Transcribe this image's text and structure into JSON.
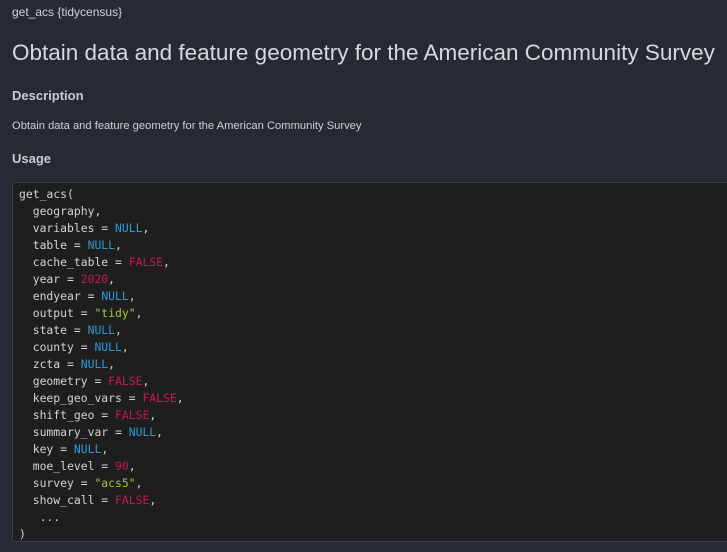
{
  "header": {
    "package_title": "get_acs {tidycensus}"
  },
  "page": {
    "title": "Obtain data and feature geometry for the American Community Survey"
  },
  "description": {
    "heading": "Description",
    "text": "Obtain data and feature geometry for the American Community Survey"
  },
  "usage": {
    "heading": "Usage",
    "code_lines": [
      {
        "text": "get_acs(",
        "type": "plain"
      },
      {
        "arg": "geography",
        "sep": ",",
        "type": "bare"
      },
      {
        "arg": "variables",
        "value": "NULL",
        "type": "null"
      },
      {
        "arg": "table",
        "value": "NULL",
        "type": "null"
      },
      {
        "arg": "cache_table",
        "value": "FALSE",
        "type": "false"
      },
      {
        "arg": "year",
        "value": "2020",
        "type": "num"
      },
      {
        "arg": "endyear",
        "value": "NULL",
        "type": "null"
      },
      {
        "arg": "output",
        "value": "\"tidy\"",
        "type": "str"
      },
      {
        "arg": "state",
        "value": "NULL",
        "type": "null"
      },
      {
        "arg": "county",
        "value": "NULL",
        "type": "null"
      },
      {
        "arg": "zcta",
        "value": "NULL",
        "type": "null"
      },
      {
        "arg": "geometry",
        "value": "FALSE",
        "type": "false"
      },
      {
        "arg": "keep_geo_vars",
        "value": "FALSE",
        "type": "false"
      },
      {
        "arg": "shift_geo",
        "value": "FALSE",
        "type": "false"
      },
      {
        "arg": "summary_var",
        "value": "NULL",
        "type": "null"
      },
      {
        "arg": "key",
        "value": "NULL",
        "type": "null"
      },
      {
        "arg": "moe_level",
        "value": "90",
        "type": "num"
      },
      {
        "arg": "survey",
        "value": "\"acs5\"",
        "type": "str"
      },
      {
        "arg": "show_call",
        "value": "FALSE",
        "type": "false"
      },
      {
        "text": "   ...",
        "type": "plain"
      },
      {
        "text": ")",
        "type": "plain"
      }
    ]
  },
  "colors": {
    "background": "#262a33",
    "code_background": "#1e1e1e",
    "null_token": "#2d9ad6",
    "false_token": "#c8165a",
    "string_token": "#9acd32"
  }
}
